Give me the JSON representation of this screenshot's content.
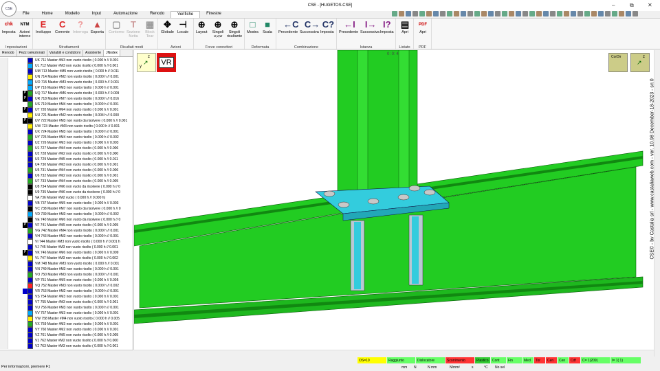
{
  "window": {
    "title": "CSE - [HUGETOS.CSE]",
    "logo": "CSE"
  },
  "menu": [
    "File",
    "Home",
    "Modello",
    "Input",
    "Automazione",
    "Renodo",
    "Verifiche",
    "Finestre"
  ],
  "menu_active": 6,
  "ribbon": {
    "groups": [
      "Impostazioni",
      "Struttamenti",
      "Risultati modi",
      "Azioni",
      "Forze connettori",
      "Deformata",
      "Combinazione",
      "Istanza",
      "Listato",
      "PDF"
    ],
    "buttons": [
      "Imposta",
      "Azioni interne",
      "Inviluppo",
      "Corrente",
      "Interroga",
      "Esporta",
      "Contorno",
      "Sezione Netta",
      "Block Tear",
      "Globale",
      "Locale",
      "Layout",
      "Singoli u,v,w",
      "Singoli risultante",
      "Mostra",
      "Scala",
      "Precedente",
      "Successiva",
      "Imposta",
      "Precedente",
      "Successiva",
      "Imposta",
      "Apri",
      "Apri"
    ],
    "icon_chk": "chk",
    "icon_ntm": "NTM"
  },
  "left": {
    "tabs": [
      "Renodo",
      "Pezzi selezionati",
      "Variabili e condizioni",
      "Assistente",
      "JNodex"
    ],
    "rows": [
      {
        "t": "UK 711  Master  #M3 non vuoto risolto ( 0.000 h // 0.001",
        "c": "#0000cc"
      },
      {
        "t": "UL 712  Master  #M3 non vuoto risolto ( 0.000 h // 0.001",
        "c": "#00aaff"
      },
      {
        "t": "UM 713  Master  #M5 non vuoto risolto ( 0.000 h // 0.011",
        "c": "#0000cc"
      },
      {
        "t": "UN 714  Master  #M2 non vuoto risolto ( 0.000 h // 0.001",
        "c": "#ffee00"
      },
      {
        "t": "UO 715  Master  #M3 non vuoto risolto ( 0.000 h // 0.001",
        "c": "#00aaff"
      },
      {
        "t": "UP 716  Master  #M3 non vuoto risolto ( 0.000 h // 0.001",
        "c": "#00aaff"
      },
      {
        "t": "UQ 717  Master  #M6 non vuoto risolto ( 0.000 h // 0.009",
        "c": "#22aa22",
        "l": "P"
      },
      {
        "t": "UR 718  Master  #M7 non vuoto risolto ( 0.000 h // 0.016",
        "c": "#0000cc",
        "l": "P"
      },
      {
        "t": "US 719  Master  #M4 non vuoto risolto ( 0.000 h // 0.001",
        "c": "#22aa22"
      },
      {
        "t": "UT 720  Master  #M4 non vuoto risolto ( 0.000 h // 0.001",
        "c": "#0000cc",
        "l": "P"
      },
      {
        "t": "UU 721  Master  #M2 non vuoto risolto ( 0.004 h // 0.000",
        "c": "#ffee00"
      },
      {
        "t": "UV 722  Master  #M3 non vuoto da risolvere ( 0.000 h // 0.001",
        "c": "#000",
        "l": "P"
      },
      {
        "t": "UW 723  Master  #M3 non vuoto risolto ( 0.000 h // 0.001",
        "c": "#ffee00"
      },
      {
        "t": "UX 724  Master  #M3 non vuoto risolto ( 0.000 h // 0.001",
        "c": "#0000cc"
      },
      {
        "t": "UY 725  Master  #M4 non vuoto risolto ( 0.000 h // 0.002",
        "c": "#22aa22"
      },
      {
        "t": "UZ 726  Master  #M3 non vuoto risolto ( 0.000 h // 0.003",
        "c": "#0000cc"
      },
      {
        "t": "U1 727  Master  #M4 non vuoto risolto ( 0.000 h // 0.006",
        "c": "#22aa22"
      },
      {
        "t": "U2 728  Master  #M2 non vuoto risolto ( 0.000 h // 0.000",
        "c": "#0000cc"
      },
      {
        "t": "U3 729  Master  #M5 non vuoto risolto ( 0.000 h // 0.011",
        "c": "#0000cc"
      },
      {
        "t": "U4 730  Master  #M3 non vuoto risolto ( 0.000 h // 0.001",
        "c": "#0000cc"
      },
      {
        "t": "U5 731  Master  #M4 non vuoto risolto ( 0.000 h // 0.006",
        "c": "#22aa22"
      },
      {
        "t": "U6 732  Master  #M2 non vuoto risolto ( 0.000 h // 0.001",
        "c": "#0000cc"
      },
      {
        "t": "U7 733  Master  #M4 non vuoto risolto ( 0.000 h // 0.005",
        "c": "#22aa22"
      },
      {
        "t": "U8 734  Master  #M6 non vuoto da risolvere ( 0.000 h // 0",
        "c": "#000"
      },
      {
        "t": "U9 735  Master  #M6 non vuoto da risolvere ( 0.000 h // 0",
        "c": "#000"
      },
      {
        "t": "VA 736  Master  #M2 vuoto ( 0.000 h // 0.000 h)",
        "c": "#fff"
      },
      {
        "t": "VB 737  Master  #M5 non vuoto risolto ( 0.000 h // 0.003",
        "c": "#0000cc"
      },
      {
        "t": "VC 738  Master  #M7 non vuoto da risolvere ( 0.000 h // 0",
        "c": "#000"
      },
      {
        "t": "VD 739  Master  #M3 non vuoto risolto ( 0.000 h // 0.002",
        "c": "#00aaff"
      },
      {
        "t": "VE 740  Master  #M6 non vuoto da risolvere ( 0.000 h // 0",
        "c": "#000"
      },
      {
        "t": "VF 741  Master  #M5 non vuoto risolto ( 0.000 h // 0.005",
        "c": "#0000cc",
        "l": "P"
      },
      {
        "t": "VG 742  Master  #M4 non vuoto risolto ( 0.000 h // 0.001",
        "c": "#22aa22"
      },
      {
        "t": "VH 743  Master  #M3 non vuoto risolto ( 0.000 h // 0.001",
        "c": "#0000cc"
      },
      {
        "t": "VI 744  Master  #M3 non vuoto risolto ( 0.000 h // 0.001 h",
        "c": "#fff"
      },
      {
        "t": "VJ 745  Master  #M3 non vuoto risolto ( 0.000 h // 0.001",
        "c": "#0000cc"
      },
      {
        "t": "VK 746  Master  #M6 non vuoto risolto ( 0.000 h // 0.009",
        "c": "#0000cc",
        "l": "P"
      },
      {
        "t": "VL 747  Master  #M3 non vuoto risolto ( 0.000 h // 0.002",
        "c": "#ffee00"
      },
      {
        "t": "VM 748  Master  #M3 non vuoto risolto ( 0.000 h // 0.001",
        "c": "#0000cc"
      },
      {
        "t": "VN 749  Master  #M3 non vuoto risolto ( 0.000 h // 0.001",
        "c": "#0000cc"
      },
      {
        "t": "VO 750  Master  #M3 non vuoto risolto ( 0.000 h // 0.001",
        "c": "#22aa22"
      },
      {
        "t": "VP 751  Master  #M5 non vuoto risolto ( 0.000 h // 0.005",
        "c": "#0000cc"
      },
      {
        "t": "VQ 752  Master  #M3 non vuoto risolto ( 0.000 h // 0.002",
        "c": "#ff2222"
      },
      {
        "t": "VR 753  Master  #M2 non vuoto risolto ( 0.000 h // 0.001",
        "c": "#0000cc",
        "l": "sel"
      },
      {
        "t": "VS 754  Master  #M3 non vuoto risolto ( 0.000 h // 0.001",
        "c": "#0000cc"
      },
      {
        "t": "VT 755  Master  #M3 non vuoto risolto ( 0.000 h // 0.001",
        "c": "#0000cc"
      },
      {
        "t": "VU 756  Master  #M3 non vuoto risolto ( 0.000 h // 0.001",
        "c": "#0000cc"
      },
      {
        "t": "VV 757  Master  #M3 non vuoto risolto ( 0.000 h // 0.001",
        "c": "#00aaff"
      },
      {
        "t": "VW 758  Master  #M4 non vuoto risolto ( 0.000 h // 0.005",
        "c": "#ffee00"
      },
      {
        "t": "VX 759  Master  #M3 non vuoto risolto ( 0.000 h // 0.001",
        "c": "#22aa22"
      },
      {
        "t": "VY 760  Master  #M2 non vuoto risolto ( 0.000 h // 0.001",
        "c": "#0000cc"
      },
      {
        "t": "VZ 761  Master  #M5 non vuoto risolto ( 0.000 h // 0.005",
        "c": "#0000cc"
      },
      {
        "t": "V1 762  Master  #M2 non vuoto risolto ( 0.000 h // 0.000",
        "c": "#0000cc"
      },
      {
        "t": "V2 763  Master  #M3 non vuoto risolto ( 0.000 h // 0.001",
        "c": "#0000cc"
      }
    ]
  },
  "viewport": {
    "badge": "VR",
    "axis_z": "z",
    "axis_y": "y",
    "counter": "0: 0: 4",
    "cordir": "CorDir",
    "watermark": "CSE© - by Castalia srl - www.castaliaweb.com - ver. 10.98 December-18-2023 - sn:0"
  },
  "status": {
    "hint": "Per informazioni, premere F1",
    "cells": [
      {
        "t": "OS=10",
        "c": "#ffff00"
      },
      {
        "t": "Raggiunto",
        "c": "#66ff66"
      },
      {
        "t": "Dislocatore",
        "c": "#66ff66"
      },
      {
        "t": "Scorrimento",
        "c": "#ff3333"
      },
      {
        "t": "Plastico",
        "c": "#33cc33"
      },
      {
        "t": "Cont",
        "c": "#66ff66"
      },
      {
        "t": "Fin",
        "c": "#66ff66"
      },
      {
        "t": "Med",
        "c": "#66ff66"
      },
      {
        "t": "Tor",
        "c": "#ff3333"
      },
      {
        "t": "Cen",
        "c": "#ff3333"
      },
      {
        "t": "Cen",
        "c": "#66ff66"
      },
      {
        "t": "Cdf",
        "c": "#ff3333"
      },
      {
        "t": "C= 1(209)",
        "c": "#66ff66"
      },
      {
        "t": "I= 1( 1)",
        "c": "#66ff66"
      }
    ],
    "units": [
      "mm",
      "N",
      "N mm",
      "N/mm²",
      "s",
      "°C",
      "No sel"
    ]
  },
  "colors": {
    "beam": "#22cc22",
    "beam_dark": "#118811",
    "plate": "#33ccdd",
    "stiff": "#aabbcc"
  }
}
